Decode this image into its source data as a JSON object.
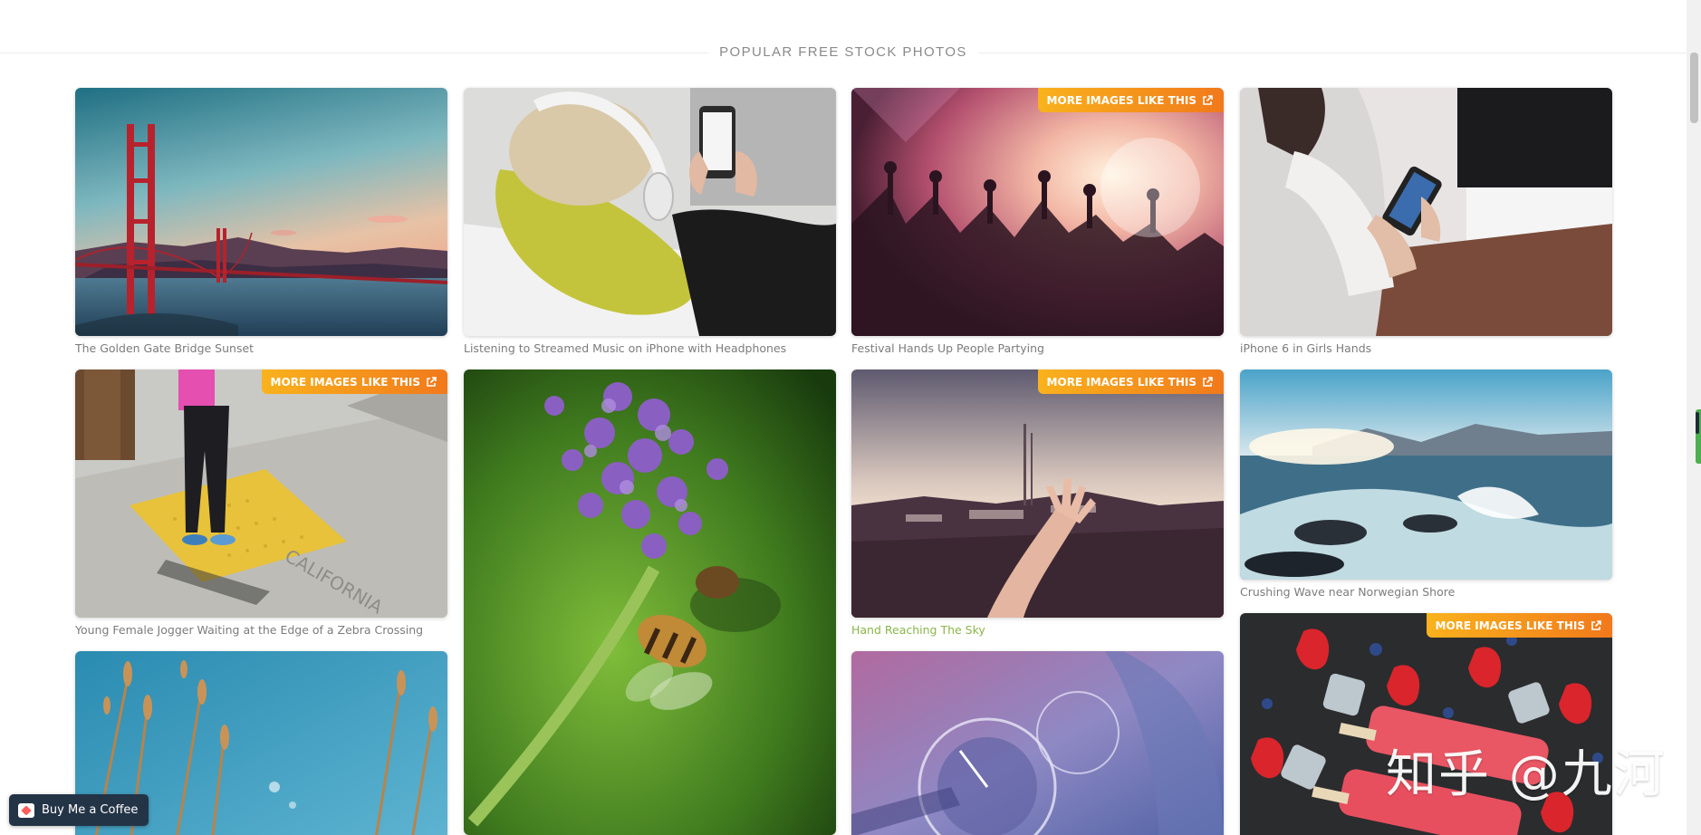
{
  "section": {
    "title": "POPULAR FREE STOCK PHOTOS"
  },
  "badge_label": "MORE IMAGES LIKE THIS",
  "columns": [
    [
      {
        "caption": "The Golden Gate Bridge Sunset",
        "badge": false,
        "scene": "golden-gate"
      },
      {
        "caption": "Young Female Jogger Waiting at the Edge of a Zebra Crossing",
        "badge": true,
        "scene": "jogger"
      },
      {
        "caption": "",
        "badge": false,
        "scene": "wheat"
      }
    ],
    [
      {
        "caption": "Listening to Streamed Music on iPhone with Headphones",
        "badge": false,
        "scene": "headphones"
      },
      {
        "caption": "",
        "badge": false,
        "scene": "bee"
      }
    ],
    [
      {
        "caption": "Festival Hands Up People Partying",
        "badge": true,
        "scene": "festival"
      },
      {
        "caption": "Hand Reaching The Sky",
        "badge": true,
        "scene": "hand-sky",
        "highlight": true
      },
      {
        "caption": "",
        "badge": false,
        "scene": "dashboard"
      }
    ],
    [
      {
        "caption": "iPhone 6 in Girls Hands",
        "badge": false,
        "scene": "iphone-girl"
      },
      {
        "caption": "Crushing Wave near Norwegian Shore",
        "badge": false,
        "scene": "wave"
      },
      {
        "caption": "",
        "badge": true,
        "scene": "popsicle"
      }
    ]
  ],
  "buy_coffee": {
    "label": "Buy Me a Coffee"
  },
  "watermark": "知乎 @九河"
}
